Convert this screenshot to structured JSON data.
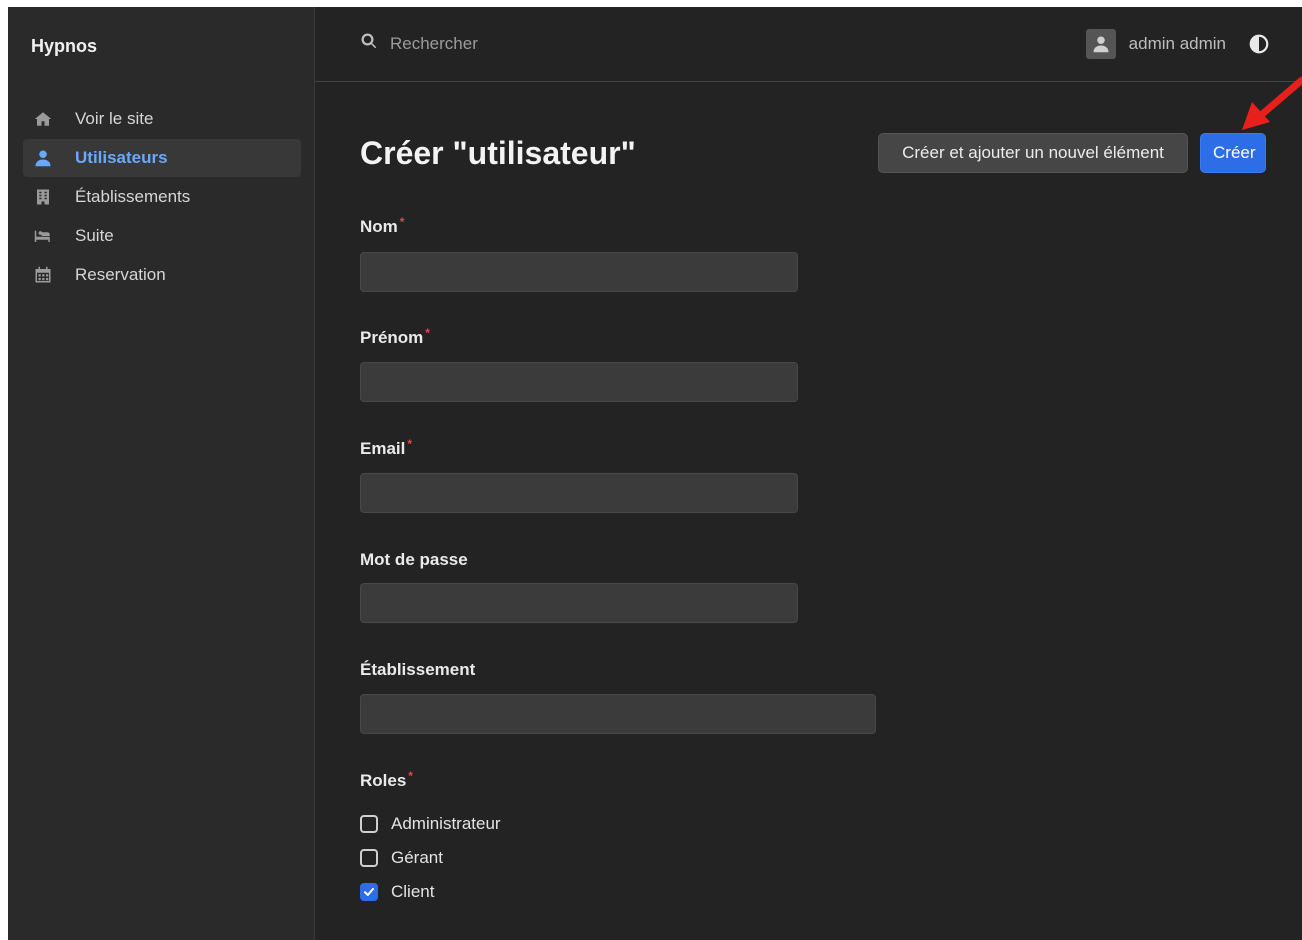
{
  "sidebar": {
    "brand": "Hypnos",
    "items": [
      {
        "label": "Voir le site",
        "icon": "home-icon"
      },
      {
        "label": "Utilisateurs",
        "icon": "user-icon",
        "active": true
      },
      {
        "label": "Établissements",
        "icon": "building-icon"
      },
      {
        "label": "Suite",
        "icon": "bed-icon"
      },
      {
        "label": "Reservation",
        "icon": "calendar-icon"
      }
    ]
  },
  "topbar": {
    "search_placeholder": "Rechercher",
    "username": "admin admin"
  },
  "page": {
    "title": "Créer \"utilisateur\"",
    "btn_create_and_add": "Créer et ajouter un nouvel élément",
    "btn_create": "Créer"
  },
  "form": {
    "nom_label": "Nom",
    "prenom_label": "Prénom",
    "email_label": "Email",
    "password_label": "Mot de passe",
    "etablissement_label": "Établissement",
    "roles_label": "Roles",
    "required_mark": "*",
    "roles": [
      {
        "label": "Administrateur",
        "checked": false
      },
      {
        "label": "Gérant",
        "checked": false
      },
      {
        "label": "Client",
        "checked": true
      }
    ]
  },
  "colors": {
    "accent": "#2d6ee8",
    "active_nav": "#6aa8ff",
    "required": "#e04a4a",
    "annotation": "#e8201b"
  }
}
